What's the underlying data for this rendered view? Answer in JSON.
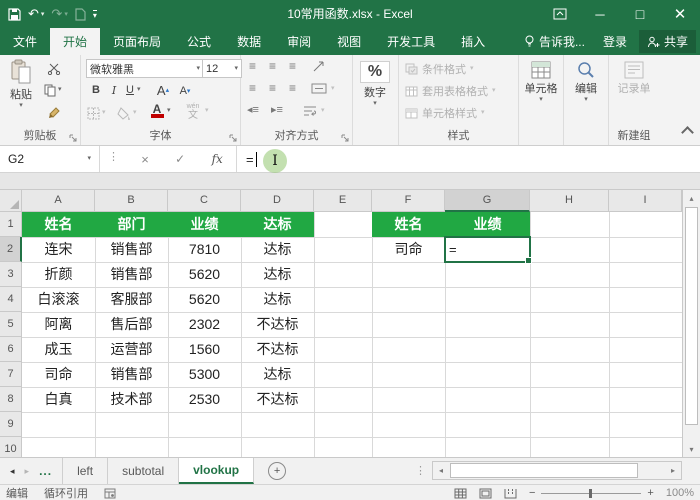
{
  "titlebar": {
    "title": "10常用函数.xlsx - Excel"
  },
  "tabs": {
    "file": "文件",
    "home": "开始",
    "layout": "页面布局",
    "formulas": "公式",
    "data": "数据",
    "review": "审阅",
    "view": "视图",
    "developer": "开发工具",
    "insert": "插入",
    "tell_me": "告诉我...",
    "sign_in": "登录",
    "share": "共享"
  },
  "ribbon": {
    "paste": "粘贴",
    "clipboard_label": "剪贴板",
    "font_name": "微软雅黑",
    "font_size": "12",
    "bold": "B",
    "italic": "I",
    "underline": "U",
    "font_color_letter": "A",
    "grow_letter": "A",
    "shrink_letter": "A",
    "phonetic": "文",
    "font_label": "字体",
    "align_label": "对齐方式",
    "percent": "%",
    "number_label": "数字",
    "cond_format": "条件格式",
    "table_format": "套用表格格式",
    "cell_styles": "单元格样式",
    "styles_label": "样式",
    "cells_btn": "单元格",
    "edit_btn": "编辑",
    "record_btn": "记录单",
    "newgroup_label": "新建组"
  },
  "formula": {
    "name_box": "G2",
    "fx": "fx",
    "value": "="
  },
  "grid": {
    "cols": [
      "A",
      "B",
      "C",
      "D",
      "E",
      "F",
      "G",
      "H",
      "I"
    ],
    "rows": [
      "1",
      "2",
      "3",
      "4",
      "5",
      "6",
      "7",
      "8",
      "9",
      "10"
    ],
    "t1h": [
      "姓名",
      "部门",
      "业绩",
      "达标"
    ],
    "t1": [
      [
        "连宋",
        "销售部",
        "7810",
        "达标"
      ],
      [
        "折颜",
        "销售部",
        "5620",
        "达标"
      ],
      [
        "白滚滚",
        "客服部",
        "5620",
        "达标"
      ],
      [
        "阿离",
        "售后部",
        "2302",
        "不达标"
      ],
      [
        "成玉",
        "运营部",
        "1560",
        "不达标"
      ],
      [
        "司命",
        "销售部",
        "5300",
        "达标"
      ],
      [
        "白真",
        "技术部",
        "2530",
        "不达标"
      ]
    ],
    "t2h": [
      "姓名",
      "业绩"
    ],
    "t2name": "司命",
    "t2value": "=",
    "active_cell": "G2"
  },
  "sheets": {
    "ellipsis": "...",
    "left": "left",
    "subtotal": "subtotal",
    "vlookup": "vlookup"
  },
  "status": {
    "mode": "编辑",
    "warn": "循环引用",
    "zoom": "100%"
  }
}
